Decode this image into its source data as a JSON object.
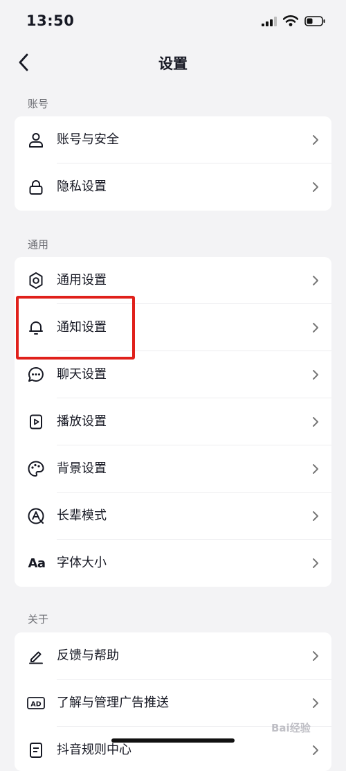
{
  "status_bar": {
    "time": "13:50",
    "icons": [
      "signal-icon",
      "wifi-icon",
      "battery-icon"
    ]
  },
  "header": {
    "title": "设置",
    "back_icon": "chevron-left-icon"
  },
  "sections": {
    "account": {
      "label": "账号",
      "items": [
        {
          "label": "账号与安全",
          "icon": "user-icon"
        },
        {
          "label": "隐私设置",
          "icon": "lock-icon"
        }
      ]
    },
    "general": {
      "label": "通用",
      "items": [
        {
          "label": "通用设置",
          "icon": "gear-icon"
        },
        {
          "label": "通知设置",
          "icon": "bell-icon"
        },
        {
          "label": "聊天设置",
          "icon": "chat-bubble-icon"
        },
        {
          "label": "播放设置",
          "icon": "play-icon"
        },
        {
          "label": "背景设置",
          "icon": "palette-icon"
        },
        {
          "label": "长辈模式",
          "icon": "elder-mode-icon"
        },
        {
          "label": "字体大小",
          "icon": "font-size-icon",
          "glyph": "Aa"
        }
      ]
    },
    "about": {
      "label": "关于",
      "items": [
        {
          "label": "反馈与帮助",
          "icon": "pencil-icon"
        },
        {
          "label": "了解与管理广告推送",
          "icon": "ad-icon",
          "glyph": "AD"
        },
        {
          "label": "抖音规则中心",
          "icon": "document-icon"
        }
      ]
    }
  },
  "highlight": {
    "color": "#e0201b",
    "target": "通知设置"
  },
  "watermark": "Bai经验",
  "colors": {
    "background": "#f3f3f5",
    "card": "#ffffff",
    "text": "#161823",
    "secondary": "#6e6f75"
  }
}
